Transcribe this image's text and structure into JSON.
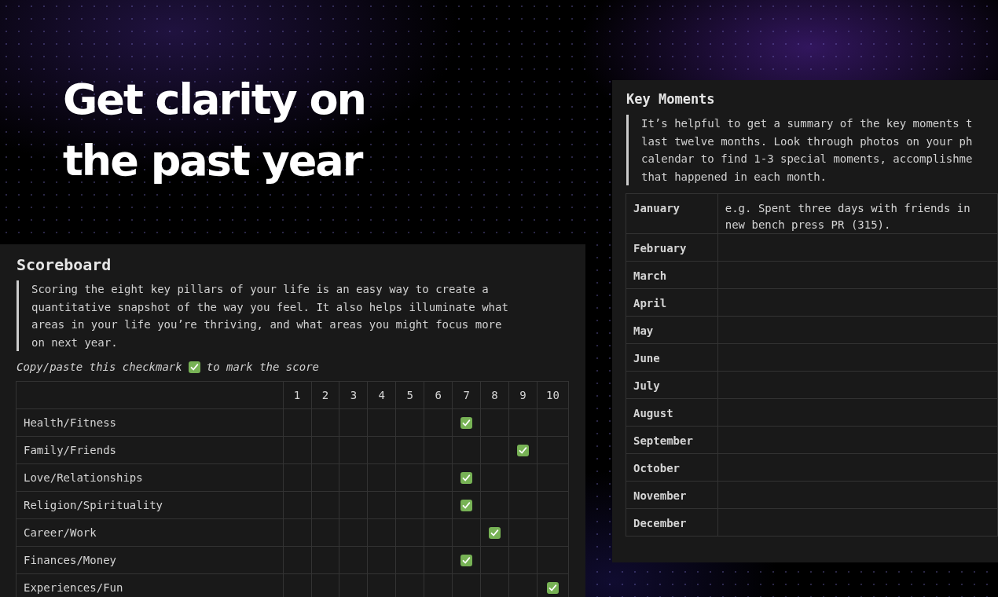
{
  "hero": {
    "lines": [
      "Get clarity on",
      "the past year"
    ]
  },
  "scoreboard": {
    "title": "Scoreboard",
    "quote": [
      "Scoring the eight key pillars of your life is an easy way to create a",
      "quantitative snapshot of the way you feel. It also helps illuminate what",
      "areas in your life you’re thriving, and what areas you might focus more",
      "on next year."
    ],
    "hint_before": "Copy/paste this checkmark",
    "hint_after": "to mark the score",
    "columns": [
      "1",
      "2",
      "3",
      "4",
      "5",
      "6",
      "7",
      "8",
      "9",
      "10"
    ],
    "rows": [
      {
        "label": "Health/Fitness",
        "checked": [
          false,
          false,
          false,
          false,
          false,
          false,
          true,
          false,
          false,
          false
        ]
      },
      {
        "label": "Family/Friends",
        "checked": [
          false,
          false,
          false,
          false,
          false,
          false,
          false,
          false,
          true,
          false
        ]
      },
      {
        "label": "Love/Relationships",
        "checked": [
          false,
          false,
          false,
          false,
          false,
          false,
          true,
          false,
          false,
          false
        ]
      },
      {
        "label": "Religion/Spirituality",
        "checked": [
          false,
          false,
          false,
          false,
          false,
          false,
          true,
          false,
          false,
          false
        ]
      },
      {
        "label": "Career/Work",
        "checked": [
          false,
          false,
          false,
          false,
          false,
          false,
          false,
          true,
          false,
          false
        ]
      },
      {
        "label": "Finances/Money",
        "checked": [
          false,
          false,
          false,
          false,
          false,
          false,
          true,
          false,
          false,
          false
        ]
      },
      {
        "label": "Experiences/Fun",
        "checked": [
          false,
          false,
          false,
          false,
          false,
          false,
          false,
          false,
          false,
          true
        ]
      }
    ]
  },
  "key_moments": {
    "title": "Key Moments",
    "quote": [
      "It’s helpful to get a summary of the key moments t",
      "last twelve months. Look through photos on your ph",
      "calendar to find 1-3 special moments, accomplishme",
      "that happened in each month."
    ],
    "rows": [
      {
        "month": "January",
        "note": [
          "e.g. Spent three days with friends in",
          "new bench press PR (315)."
        ]
      },
      {
        "month": "February"
      },
      {
        "month": "March"
      },
      {
        "month": "April"
      },
      {
        "month": "May"
      },
      {
        "month": "June"
      },
      {
        "month": "July"
      },
      {
        "month": "August"
      },
      {
        "month": "September"
      },
      {
        "month": "October"
      },
      {
        "month": "November"
      },
      {
        "month": "December"
      }
    ]
  }
}
